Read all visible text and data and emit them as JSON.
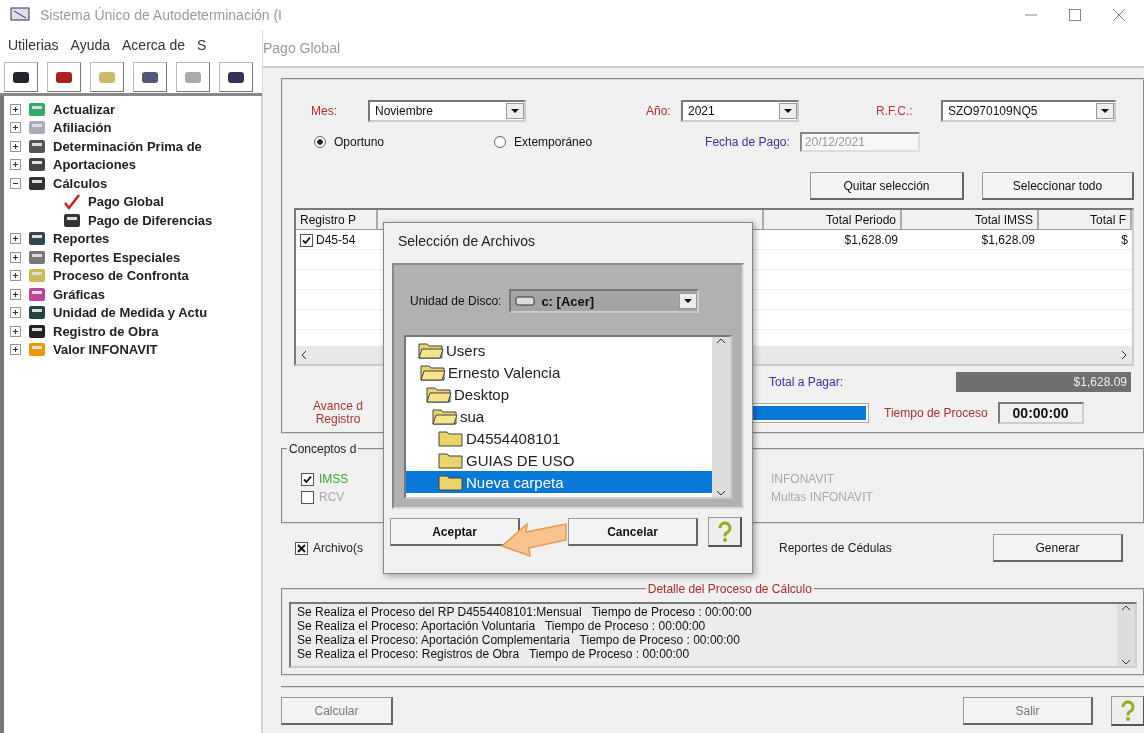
{
  "window": {
    "title": "Sistema Único de Autodeterminación (I"
  },
  "menu": [
    "Utilerias",
    "Ayuda",
    "Acerca de",
    "S"
  ],
  "tree": [
    {
      "label": "Actualizar",
      "expanded": false
    },
    {
      "label": "Afiliación",
      "expanded": false
    },
    {
      "label": "Determinación Prima de",
      "expanded": false
    },
    {
      "label": "Aportaciones",
      "expanded": false
    },
    {
      "label": "Cálculos",
      "expanded": true,
      "children": [
        {
          "label": "Pago Global"
        },
        {
          "label": "Pago de Diferencias"
        }
      ]
    },
    {
      "label": "Reportes",
      "expanded": false
    },
    {
      "label": "Reportes Especiales",
      "expanded": false
    },
    {
      "label": "Proceso de Confronta",
      "expanded": false
    },
    {
      "label": "Gráficas",
      "expanded": false
    },
    {
      "label": "Unidad de Medida y Actu",
      "expanded": false
    },
    {
      "label": "Registro de Obra",
      "expanded": false
    },
    {
      "label": "Valor INFONAVIT",
      "expanded": false
    }
  ],
  "pago_global": {
    "title": "Pago Global",
    "mes": {
      "label": "Mes:",
      "value": "Noviembre"
    },
    "anio": {
      "label": "Año:",
      "value": "2021"
    },
    "rfc": {
      "label": "R.F.C.:",
      "value": "SZO970109NQ5"
    },
    "payment_type": [
      {
        "label": "Oportuno",
        "selected": true
      },
      {
        "label": "Extemporáneo",
        "selected": false
      }
    ],
    "fecha_pago": {
      "label": "Fecha de Pago:",
      "value": "20/12/2021",
      "disabled": true
    },
    "buttons": [
      "Quitar selección",
      "Seleccionar todo"
    ],
    "table": {
      "columns": [
        "Registro P",
        "Total Periodo",
        "Total IMSS",
        "Total F"
      ],
      "rows": [
        {
          "checked": true,
          "cells": [
            "D45-54",
            "$1,628.09",
            "$1,628.09",
            "$"
          ]
        }
      ]
    },
    "total": {
      "label": "Total a Pagar:",
      "value": "$1,628.09"
    },
    "progress": {
      "label": [
        "Avance d",
        "Registro"
      ],
      "level": 1,
      "time_label": "Tiempo de Proceso",
      "time": "00:00:00"
    },
    "concepts": {
      "title": "Conceptos d",
      "items": [
        {
          "label": "IMSS",
          "checked": true,
          "disabled": false
        },
        {
          "label": "RCV",
          "checked": false,
          "disabled": true
        }
      ],
      "more": [
        {
          "label": "INFONAVIT",
          "disabled": true
        },
        {
          "label": "Multas INFONAVIT",
          "disabled": true
        }
      ]
    },
    "files_checkbox": {
      "label": "Archivo(s",
      "checked": true
    },
    "reports_label": "Reportes de Cédulas",
    "generate_button": "Generar",
    "detail": {
      "title": "Detalle del Proceso de Cálculo",
      "lines": [
        "Se Realiza el Proceso del RP D4554408101:Mensual   Tiempo de Proceso : 00:00:00",
        "Se Realiza el Proceso: Aportación Voluntaria   Tiempo de Proceso : 00:00:00",
        "Se Realiza el Proceso: Aportación Complementaria   Tiempo de Proceso : 00:00:00",
        "Se Realiza el Proceso: Registros de Obra   Tiempo de Proceso : 00:00:00"
      ]
    },
    "calc_button": {
      "label": "Calcular",
      "disabled": true
    },
    "exit_button": {
      "label": "Salir",
      "disabled": true
    }
  },
  "dialog": {
    "title": "Selección de Archivos",
    "drive_label": "Unidad de Disco:",
    "drive": "c: [Acer]",
    "folders": [
      {
        "label": "Users",
        "selected": false,
        "children": [
          {
            "label": "Ernesto Valencia",
            "selected": false,
            "children": [
              {
                "label": "Desktop",
                "selected": false,
                "children": [
                  {
                    "label": "sua",
                    "selected": false,
                    "children": [
                      {
                        "label": "D4554408101",
                        "selected": false
                      },
                      {
                        "label": "GUIAS DE USO",
                        "selected": false
                      },
                      {
                        "label": "Nueva carpeta",
                        "selected": true
                      }
                    ]
                  }
                ]
              }
            ]
          }
        ]
      }
    ],
    "buttons": [
      "Aceptar",
      "Cancelar"
    ]
  }
}
